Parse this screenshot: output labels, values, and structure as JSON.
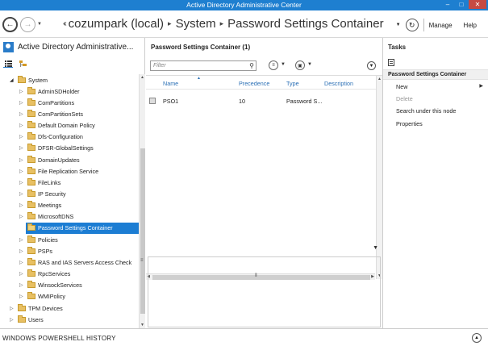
{
  "window": {
    "title": "Active Directory Administrative Center",
    "controls": [
      "–",
      "□",
      "✕"
    ]
  },
  "nav": {
    "back_glyph": "←",
    "forward_glyph": "→",
    "dropdown_glyph": "▼",
    "breadcrumb_prefix": "‹‹",
    "breadcrumb": [
      "cozumpark (local)",
      "System",
      "Password Settings Container"
    ],
    "separator_glyph": "▸",
    "refresh_glyph": "↻",
    "manage_label": "Manage",
    "help_label": "Help"
  },
  "left_pane": {
    "title": "Active Directory Administrative...",
    "tree": [
      {
        "label": "System",
        "level": 0,
        "expanded": true
      },
      {
        "label": "AdminSDHolder",
        "level": 1
      },
      {
        "label": "ComPartitions",
        "level": 1
      },
      {
        "label": "ComPartitionSets",
        "level": 1
      },
      {
        "label": "Default Domain Policy",
        "level": 1
      },
      {
        "label": "Dfs-Configuration",
        "level": 1
      },
      {
        "label": "DFSR-GlobalSettings",
        "level": 1
      },
      {
        "label": "DomainUpdates",
        "level": 1
      },
      {
        "label": "File Replication Service",
        "level": 1
      },
      {
        "label": "FileLinks",
        "level": 1
      },
      {
        "label": "IP Security",
        "level": 1
      },
      {
        "label": "Meetings",
        "level": 1
      },
      {
        "label": "MicrosoftDNS",
        "level": 1
      },
      {
        "label": "Password Settings Container",
        "level": 1,
        "selected": true,
        "leaf": true
      },
      {
        "label": "Policies",
        "level": 1
      },
      {
        "label": "PSPs",
        "level": 1
      },
      {
        "label": "RAS and IAS Servers Access Check",
        "level": 1
      },
      {
        "label": "RpcServices",
        "level": 1
      },
      {
        "label": "WinsockServices",
        "level": 1
      },
      {
        "label": "WMIPolicy",
        "level": 1
      },
      {
        "label": "TPM Devices",
        "level": 0
      },
      {
        "label": "Users",
        "level": 0
      }
    ]
  },
  "center": {
    "header": "Password Settings Container  (1)",
    "filter_placeholder": "Filter",
    "columns": [
      "Name",
      "Precedence",
      "Type",
      "Description"
    ],
    "rows": [
      {
        "name": "PSO1",
        "precedence": "10",
        "type": "Password S...",
        "description": ""
      }
    ]
  },
  "tasks": {
    "title": "Tasks",
    "section": "Password Settings Container",
    "items": [
      {
        "label": "New",
        "enabled": true,
        "submenu": true
      },
      {
        "label": "Delete",
        "enabled": false
      },
      {
        "label": "Search under this node",
        "enabled": true
      },
      {
        "label": "Properties",
        "enabled": true
      }
    ]
  },
  "bottom": {
    "label": "WINDOWS POWERSHELL HISTORY"
  },
  "colors": {
    "titlebar": "#1e7fd0",
    "selection": "#1c7dd3",
    "close_button": "#c74b43"
  }
}
